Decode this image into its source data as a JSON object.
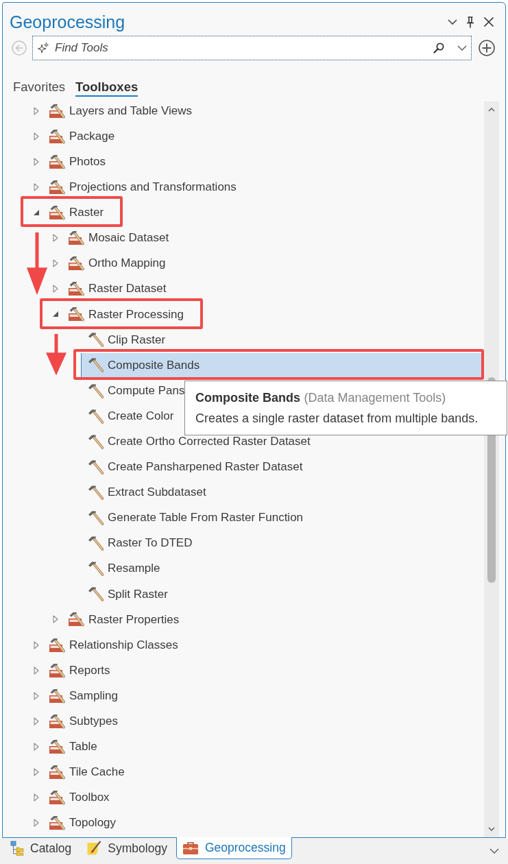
{
  "panel": {
    "title": "Geoprocessing"
  },
  "search": {
    "placeholder": "Find Tools"
  },
  "tabs": [
    {
      "label": "Favorites",
      "selected": false
    },
    {
      "label": "Toolboxes",
      "selected": true
    }
  ],
  "tree": [
    {
      "kind": "toolbox",
      "label": "Layers and Table Views",
      "expanded": false,
      "selected": false,
      "marked": false
    },
    {
      "kind": "toolbox",
      "label": "Package",
      "expanded": false,
      "selected": false,
      "marked": false
    },
    {
      "kind": "toolbox",
      "label": "Photos",
      "expanded": false,
      "selected": false,
      "marked": false
    },
    {
      "kind": "toolbox",
      "label": "Projections and Transformations",
      "expanded": false,
      "selected": false,
      "marked": false
    },
    {
      "kind": "toolbox",
      "label": "Raster",
      "expanded": true,
      "selected": false,
      "marked": true,
      "children": [
        {
          "kind": "toolbox",
          "label": "Mosaic Dataset",
          "expanded": false,
          "selected": false,
          "marked": false
        },
        {
          "kind": "toolbox",
          "label": "Ortho Mapping",
          "expanded": false,
          "selected": false,
          "marked": false
        },
        {
          "kind": "toolbox",
          "label": "Raster Dataset",
          "expanded": false,
          "selected": false,
          "marked": false
        },
        {
          "kind": "toolbox",
          "label": "Raster Processing",
          "expanded": true,
          "selected": false,
          "marked": true,
          "children": [
            {
              "kind": "tool",
              "label": "Clip Raster",
              "selected": false,
              "marked": false
            },
            {
              "kind": "tool",
              "label": "Composite Bands",
              "selected": true,
              "marked": true
            },
            {
              "kind": "tool",
              "label": "Compute Pans",
              "selected": false,
              "marked": false
            },
            {
              "kind": "tool",
              "label": "Create Color",
              "selected": false,
              "marked": false
            },
            {
              "kind": "tool",
              "label": "Create Ortho Corrected Raster Dataset",
              "selected": false,
              "marked": false
            },
            {
              "kind": "tool",
              "label": "Create Pansharpened Raster Dataset",
              "selected": false,
              "marked": false
            },
            {
              "kind": "tool",
              "label": "Extract Subdataset",
              "selected": false,
              "marked": false
            },
            {
              "kind": "tool",
              "label": "Generate Table From Raster Function",
              "selected": false,
              "marked": false
            },
            {
              "kind": "tool",
              "label": "Raster To DTED",
              "selected": false,
              "marked": false
            },
            {
              "kind": "tool",
              "label": "Resample",
              "selected": false,
              "marked": false
            },
            {
              "kind": "tool",
              "label": "Split Raster",
              "selected": false,
              "marked": false
            }
          ]
        },
        {
          "kind": "toolbox",
          "label": "Raster Properties",
          "expanded": false,
          "selected": false,
          "marked": false
        }
      ]
    },
    {
      "kind": "toolbox",
      "label": "Relationship Classes",
      "expanded": false,
      "selected": false,
      "marked": false
    },
    {
      "kind": "toolbox",
      "label": "Reports",
      "expanded": false,
      "selected": false,
      "marked": false
    },
    {
      "kind": "toolbox",
      "label": "Sampling",
      "expanded": false,
      "selected": false,
      "marked": false
    },
    {
      "kind": "toolbox",
      "label": "Subtypes",
      "expanded": false,
      "selected": false,
      "marked": false
    },
    {
      "kind": "toolbox",
      "label": "Table",
      "expanded": false,
      "selected": false,
      "marked": false
    },
    {
      "kind": "toolbox",
      "label": "Tile Cache",
      "expanded": false,
      "selected": false,
      "marked": false
    },
    {
      "kind": "toolbox",
      "label": "Toolbox",
      "expanded": false,
      "selected": false,
      "marked": false
    },
    {
      "kind": "toolbox",
      "label": "Topology",
      "expanded": false,
      "selected": false,
      "marked": false
    }
  ],
  "tooltip": {
    "title": "Composite Bands",
    "source": "(Data Management Tools)",
    "description": "Creates a single raster dataset from multiple bands."
  },
  "dock_tabs": [
    {
      "kind": "catalog",
      "label": "Catalog",
      "selected": false
    },
    {
      "kind": "symbology",
      "label": "Symbology",
      "selected": false
    },
    {
      "kind": "geoprocessing",
      "label": "Geoprocessing",
      "selected": true
    }
  ]
}
